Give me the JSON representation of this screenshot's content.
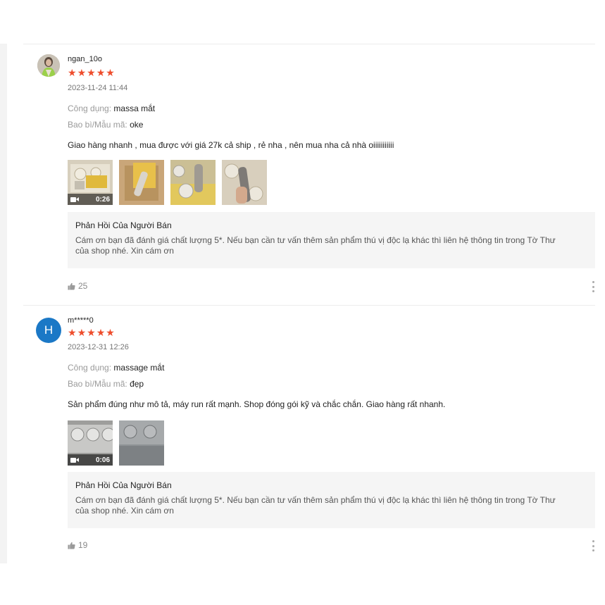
{
  "reviews": [
    {
      "username": "ngan_10o",
      "avatar_type": "photo",
      "rating": 5,
      "date": "2023-11-24 11:44",
      "attributes": [
        {
          "key": "Công dụng:",
          "value": "massa mắt"
        },
        {
          "key": "Bao bì/Mẫu mã:",
          "value": "oke"
        }
      ],
      "comment": "Giao hàng nhanh , mua được với giá 27k cả ship , rẻ nha , nên mua nha cả nhà oiiiiiiiiiii",
      "video_duration": "0:26",
      "media_count": 4,
      "reply": {
        "title": "Phản Hồi Của Người Bán",
        "line1": "Cám ơn bạn đã đánh giá chất lượng 5*. Nếu bạn cần tư vấn thêm sản phẩm thú vị độc lạ khác thì liên hệ thông tin trong Tờ Thư",
        "line2": "của shop nhé. Xin cám ơn"
      },
      "likes": "25"
    },
    {
      "username": "m*****0",
      "avatar_type": "letter",
      "avatar_letter": "H",
      "rating": 5,
      "date": "2023-12-31 12:26",
      "attributes": [
        {
          "key": "Công dụng:",
          "value": "massage mắt"
        },
        {
          "key": "Bao bì/Mẫu mã:",
          "value": "đẹp"
        }
      ],
      "comment": "Sản phẩm đúng như mô tả, máy run rất mạnh. Shop đóng gói kỹ và chắc chắn. Giao hàng rất nhanh.",
      "video_duration": "0:06",
      "media_count": 2,
      "reply": {
        "title": "Phản Hồi Của Người Bán",
        "line1": "Cám ơn bạn đã đánh giá chất lượng 5*. Nếu bạn cần tư vấn thêm sản phẩm thú vị độc lạ khác thì liên hệ thông tin trong Tờ Thư",
        "line2": "của shop nhé. Xin cám ơn"
      },
      "likes": "19"
    }
  ],
  "icons": {
    "star": "star-icon",
    "video": "video-camera-icon",
    "like": "thumbs-up-icon",
    "more": "more-vertical-icon"
  },
  "colors": {
    "star": "#ee4d2d",
    "avatar_h": "#1b78c6",
    "reply_bg": "#f5f5f5"
  }
}
